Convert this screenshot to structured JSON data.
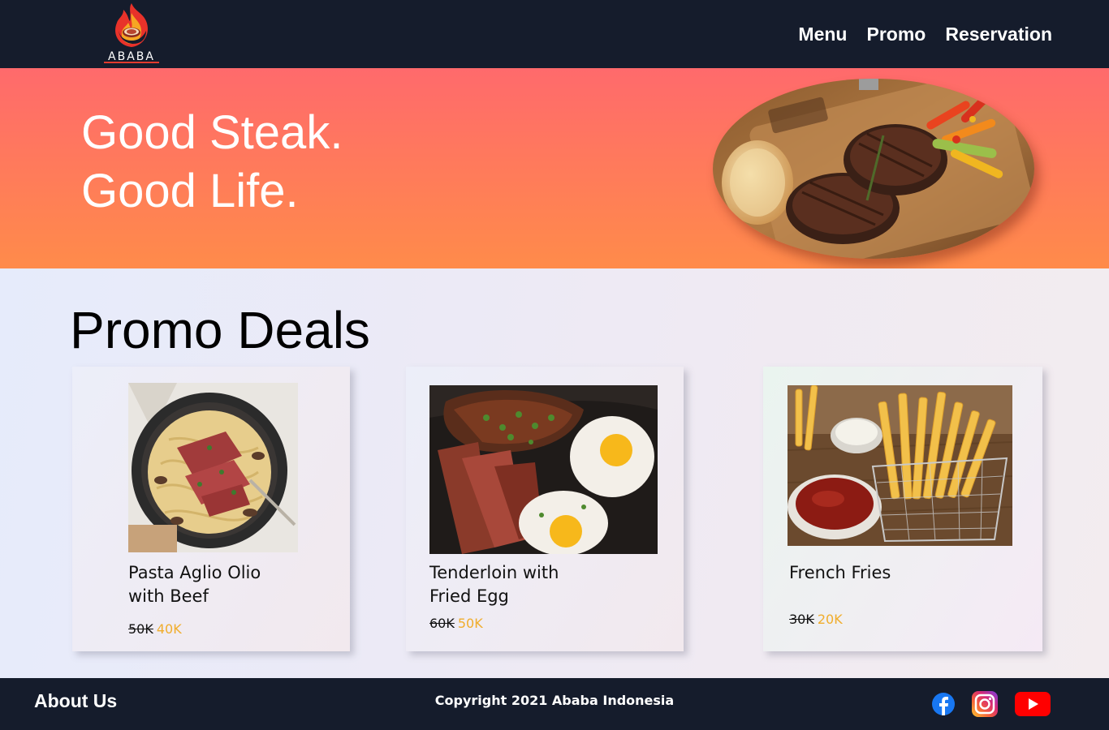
{
  "header": {
    "logo_text": "ABABA",
    "nav": [
      {
        "label": "Menu"
      },
      {
        "label": "Promo"
      },
      {
        "label": "Reservation"
      }
    ]
  },
  "hero": {
    "line1": "Good Steak.",
    "line2": "Good Life.",
    "image_icon": "steak-plate-photo"
  },
  "promo": {
    "heading": "Promo Deals",
    "items": [
      {
        "name_line1": "Pasta Aglio Olio",
        "name_line2": "with Beef",
        "old_price": "50K",
        "new_price": "40K",
        "photo": "pasta-beef-photo"
      },
      {
        "name_line1": "Tenderloin with",
        "name_line2": "Fried Egg",
        "old_price": "60K",
        "new_price": "50K",
        "photo": "tenderloin-egg-photo"
      },
      {
        "name_line1": "French Fries",
        "name_line2": "",
        "old_price": "30K",
        "new_price": "20K",
        "photo": "french-fries-photo"
      }
    ]
  },
  "footer": {
    "about": "About Us",
    "copyright": "Copyright 2021 Ababa Indonesia",
    "social": [
      "facebook-icon",
      "instagram-icon",
      "youtube-icon"
    ]
  },
  "colors": {
    "header_bg": "#151c2c",
    "hero_gradient_top": "#ff6a6c",
    "hero_gradient_bottom": "#ff8b4a",
    "discount_price": "#f0ad2c"
  }
}
